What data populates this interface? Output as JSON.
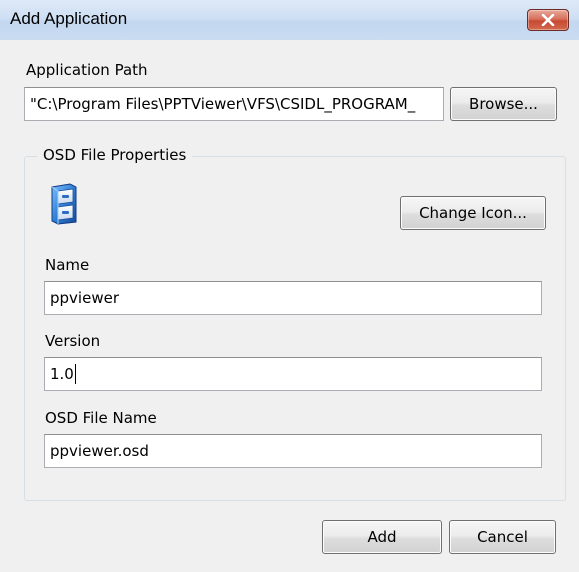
{
  "window": {
    "title": "Add Application",
    "close_icon": "close-x-icon"
  },
  "app_path": {
    "label": "Application Path",
    "value": "\"C:\\Program Files\\PPTViewer\\VFS\\CSIDL_PROGRAM_",
    "browse_label": "Browse..."
  },
  "osd": {
    "group_label": "OSD File Properties",
    "icon": "application-file-icon",
    "change_icon_label": "Change Icon...",
    "name_label": "Name",
    "name_value": "ppviewer",
    "version_label": "Version",
    "version_value": "1.0",
    "filename_label": "OSD File Name",
    "filename_value": "ppviewer.osd"
  },
  "footer": {
    "add_label": "Add",
    "cancel_label": "Cancel"
  },
  "colors": {
    "title_bar": "#c9dcf2",
    "close_button": "#c74a33",
    "dialog_background": "#f0f0f0",
    "icon_blue": "#2f7fd6"
  }
}
